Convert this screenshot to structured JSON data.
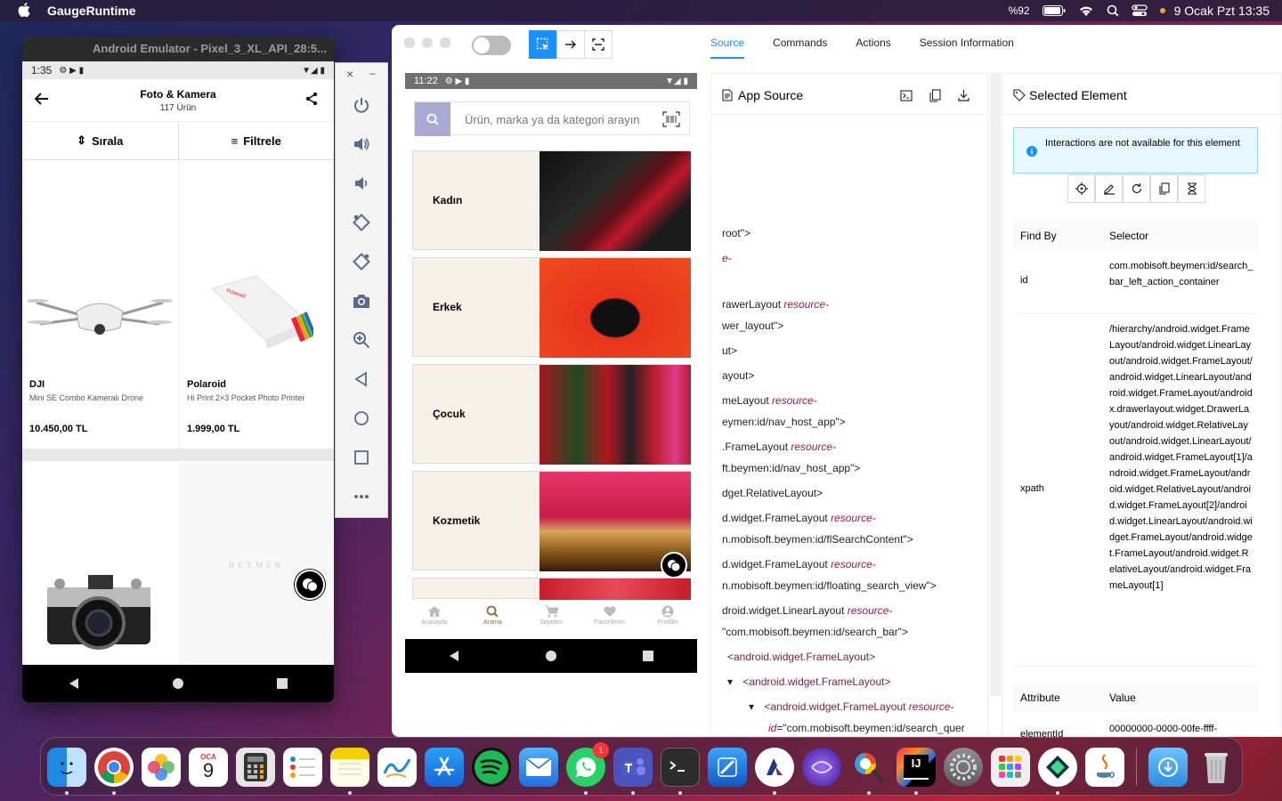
{
  "menubar": {
    "app_name": "GaugeRuntime",
    "battery": "%92",
    "datetime": "9 Ocak Pzt  13:35"
  },
  "emulator": {
    "window_title": "Android Emulator - Pixel_3_XL_API_28:5...",
    "status_time": "1:35",
    "header_title": "Foto & Kamera",
    "header_subtitle": "117 Ürün",
    "sort_label": "Sırala",
    "filter_label": "Filtrele",
    "products": [
      {
        "brand": "DJI",
        "desc": "Mini SE Combo Kameralı Drone",
        "price": "10.450,00 TL"
      },
      {
        "brand": "Polaroid",
        "desc": "Hi Print 2×3 Pocket Photo Printer",
        "price": "1.999,00 TL"
      }
    ],
    "placeholder_brand": "BEYMEN"
  },
  "emulator_sidebar": {
    "close": "×",
    "minimize": "–",
    "tools": [
      "power-icon",
      "volume-up-icon",
      "volume-down-icon",
      "rotate-left-icon",
      "rotate-right-icon",
      "camera-icon",
      "zoom-icon",
      "back-icon",
      "home-icon",
      "overview-icon",
      "more-icon"
    ]
  },
  "inspector": {
    "tabs": [
      "Source",
      "Commands",
      "Actions",
      "Session Information"
    ],
    "active_tab": "Source",
    "device": {
      "status_time": "11:22",
      "search_placeholder": "Ürün, marka ya da kategori arayın",
      "categories": [
        "Kadın",
        "Erkek",
        "Çocuk",
        "Kozmetik"
      ],
      "tabbar": [
        "Anasayfa",
        "Arama",
        "Sepetim",
        "Favorilerim",
        "Profilim"
      ]
    },
    "source": {
      "title": "App Source",
      "lines": [
        {
          "plain": "root\">",
          "attr": ""
        },
        {
          "plain": "",
          "attr": "e-"
        },
        {
          "plain": "rawerLayout ",
          "attr": "resource-"
        },
        {
          "plain": "wer_layout\">",
          "attr": ""
        },
        {
          "plain": "ut>",
          "attr": ""
        },
        {
          "plain": "ayout>",
          "attr": ""
        },
        {
          "plain": "meLayout ",
          "attr": "resource-"
        },
        {
          "plain": "eymen:id/nav_host_app\">",
          "attr": ""
        },
        {
          "plain": ".FrameLayout ",
          "attr": "resource-"
        },
        {
          "plain": "ft.beymen:id/nav_host_app\">",
          "attr": ""
        },
        {
          "plain": "dget.RelativeLayout>",
          "attr": ""
        },
        {
          "plain": "d.widget.FrameLayout ",
          "attr": "resource-"
        },
        {
          "plain": "n.mobisoft.beymen:id/flSearchContent\">",
          "attr": ""
        },
        {
          "plain": "d.widget.FrameLayout ",
          "attr": "resource-"
        },
        {
          "plain": "n.mobisoft.beymen:id/floating_search_view\">",
          "attr": ""
        },
        {
          "plain": "droid.widget.LinearLayout ",
          "attr": "resource-"
        },
        {
          "plain": "\"com.mobisoft.beymen:id/search_bar\">",
          "attr": ""
        },
        {
          "plain": "<android.widget.FrameLayout>",
          "attr": ""
        },
        {
          "plain": "<android.widget.FrameLayout>",
          "attr": ""
        },
        {
          "plain": "<android.widget.FrameLayout ",
          "attr": "resource-"
        },
        {
          "plain": "=\"com.mobisoft.beymen:id/search_quer",
          "attr": "id"
        }
      ]
    },
    "selected": {
      "title": "Selected Element",
      "info": "Interactions are not available for this element",
      "find_by_header": "Find By",
      "selector_header": "Selector",
      "rows": [
        {
          "key": "id",
          "value": "com.mobisoft.beymen:id/search_bar_left_action_container"
        },
        {
          "key": "xpath",
          "value": "/hierarchy/android.widget.FrameLayout/android.widget.LinearLayout/android.widget.FrameLayout/android.widget.LinearLayout/android.widget.FrameLayout/androidx.drawerlayout.widget.DrawerLayout/android.widget.RelativeLayout/android.widget.LinearLayout/android.widget.FrameLayout[1]/android.widget.FrameLayout/android.widget.RelativeLayout/android.widget.FrameLayout[2]/android.widget.LinearLayout/android.widget.FrameLayout/android.widget.FrameLayout/android.widget.RelativeLayout/android.widget.FrameLayout[1]"
        }
      ],
      "attr_header": "Attribute",
      "value_header": "Value",
      "attr_row": {
        "key": "elementId",
        "value": "00000000-0000-00fe-ffff-"
      }
    }
  },
  "dock": {
    "calendar_month": "OCA",
    "calendar_day": "9",
    "whatsapp_badge": "1",
    "intellij_label": "IJ"
  },
  "colors": {
    "accent": "#1890ff",
    "brand_gold": "#8a6d3b"
  }
}
